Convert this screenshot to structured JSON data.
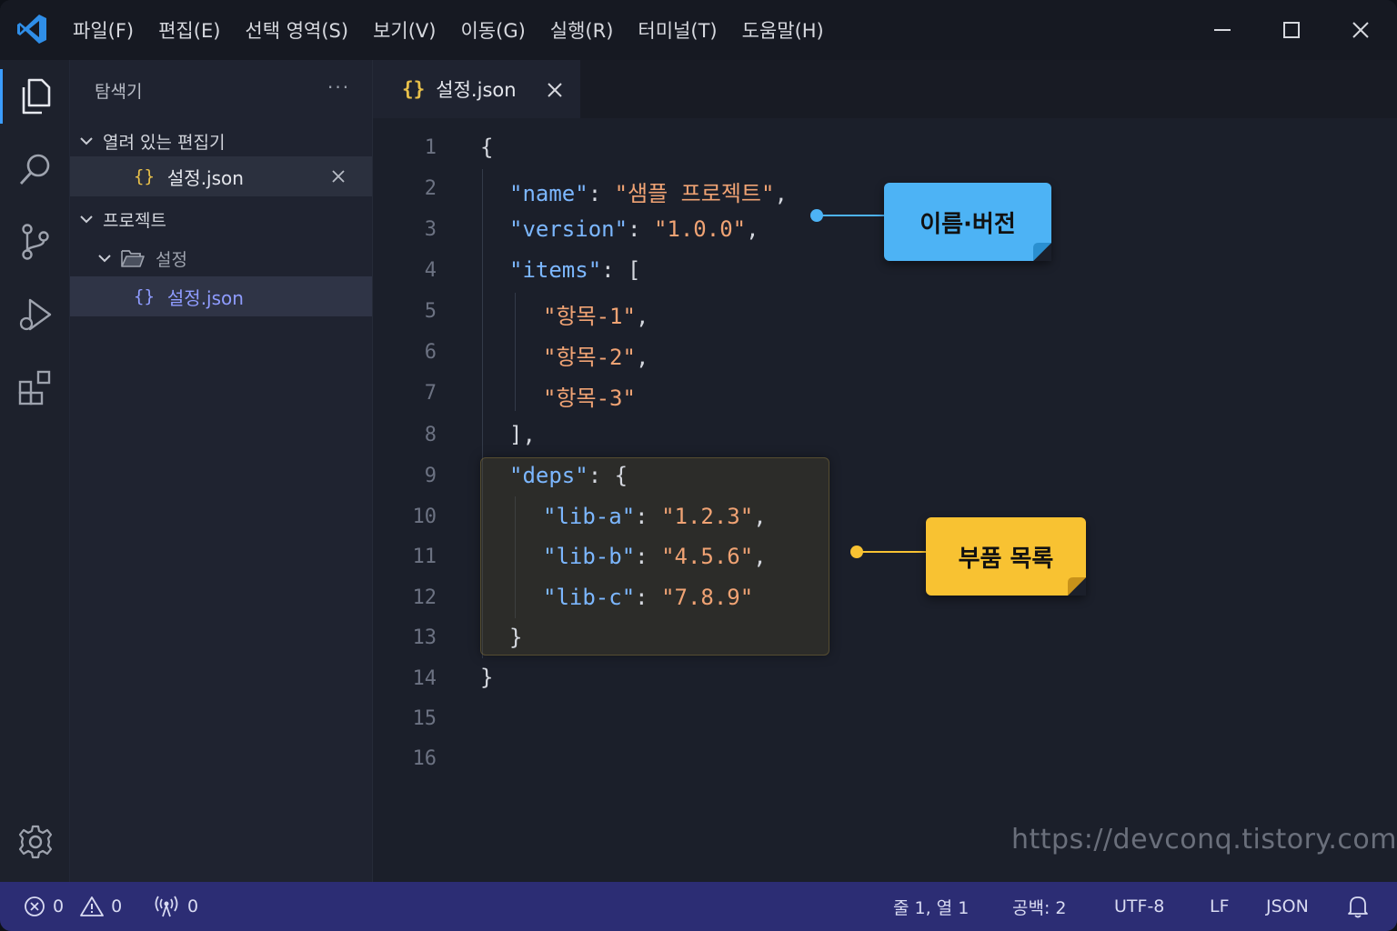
{
  "window": {
    "menu": [
      "파일(F)",
      "편집(E)",
      "선택 영역(S)",
      "보기(V)",
      "이동(G)",
      "실행(R)",
      "터미널(T)",
      "도움말(H)"
    ]
  },
  "activity_bar": {
    "items": [
      "explorer-icon",
      "search-icon",
      "source-control-icon",
      "run-debug-icon",
      "extensions-icon"
    ],
    "bottom": "settings-gear-icon",
    "active": "explorer-icon"
  },
  "sidebar": {
    "title": "탐색기",
    "more": "···",
    "open_editors": {
      "label": "열려 있는 편집기",
      "files": [
        {
          "icon": "{}",
          "name": "설정.json"
        }
      ]
    },
    "project": {
      "label": "프로젝트",
      "folder": "설정",
      "file": {
        "icon": "{}",
        "name": "설정.json"
      }
    }
  },
  "editor": {
    "tab": {
      "icon": "{}",
      "name": "설정.json"
    },
    "line_numbers": [
      "1",
      "2",
      "3",
      "4",
      "5",
      "6",
      "7",
      "8",
      "9",
      "10",
      "11",
      "12",
      "13",
      "14",
      "15",
      "16"
    ],
    "code": {
      "l1": "{",
      "name_key": "\"name\"",
      "name_val": "\"샘플 프로젝트\"",
      "version_key": "\"version\"",
      "version_val": "\"1.0.0\"",
      "items_key": "\"items\"",
      "item1": "\"항목-1\"",
      "item2": "\"항목-2\"",
      "item3": "\"항목-3\"",
      "items_close": "],",
      "deps_key": "\"deps\"",
      "lib_a_key": "\"lib-a\"",
      "lib_a_val": "\"1.2.3\"",
      "lib_b_key": "\"lib-b\"",
      "lib_b_val": "\"4.5.6\"",
      "lib_c_key": "\"lib-c\"",
      "lib_c_val": "\"7.8.9\"",
      "deps_close": "}",
      "l14": "}"
    },
    "callouts": [
      {
        "text": "이름·버전",
        "color": "#4db3f5"
      },
      {
        "text": "부품 목록",
        "color": "#f8c232"
      }
    ],
    "watermark": "https://devconq.tistory.com"
  },
  "status_bar": {
    "errors": "0",
    "warnings": "0",
    "ports": "0",
    "position": "줄 1, 열 1",
    "indent": "공백: 2",
    "encoding": "UTF-8",
    "eol": "LF",
    "language": "JSON"
  }
}
